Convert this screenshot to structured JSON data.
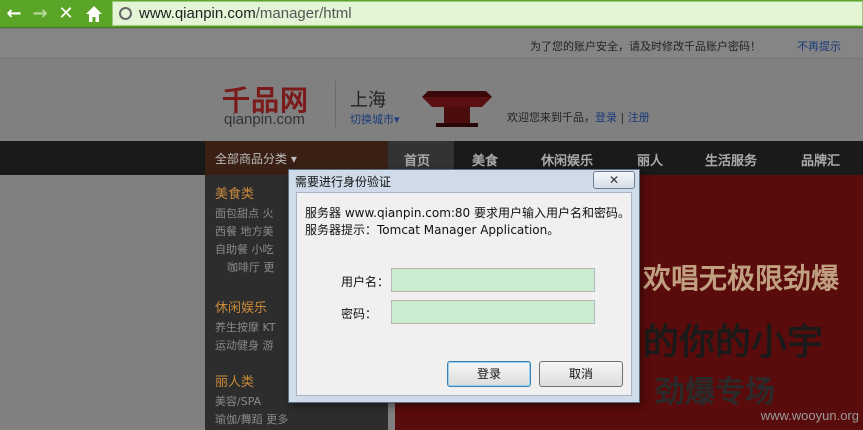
{
  "browser": {
    "url_host": "www.qianpin.com",
    "url_path": "/manager/html",
    "back_icon": "arrow-left",
    "forward_icon": "arrow-right",
    "stop_icon": "close",
    "home_icon": "home"
  },
  "notice": {
    "text": "为了您的账户安全，请及时修改千品账户密码！",
    "link": "不再提示"
  },
  "header": {
    "logo_cn": "千品网",
    "logo_en": "qianpin.com",
    "city": "上海",
    "city_switch": "切换城市▾",
    "welcome": "欢迎您来到千品，",
    "login": "登录",
    "separator": "|",
    "register": "注册"
  },
  "nav": {
    "all_categories": "全部商品分类 ▾",
    "items": [
      "首页",
      "美食",
      "休闲娱乐",
      "丽人",
      "生活服务",
      "品牌汇"
    ]
  },
  "sidebar": {
    "groups": [
      {
        "title": "美食类",
        "items": [
          "面包甜点  火",
          "西餐  地方美",
          "自助餐  小吃",
          "咖啡厅  更"
        ]
      },
      {
        "title": "休闲娱乐",
        "items": [
          "养生按摩  KT",
          "运动健身  游"
        ]
      },
      {
        "title": "丽人类",
        "items": [
          "美容/SPA",
          "瑜伽/舞蹈  更多"
        ]
      }
    ]
  },
  "banner": {
    "line1": "欢唱无极限劲爆",
    "line2": "的你的小宇",
    "line3": "劲爆专场"
  },
  "watermark": "www.wooyun.org",
  "dialog": {
    "title": "需要进行身份验证",
    "close_label": "✕",
    "message_line1": "服务器 www.qianpin.com:80 要求用户输入用户名和密码。",
    "message_line2": "服务器提示：Tomcat Manager Application。",
    "username_label": "用户名：",
    "password_label": "密码：",
    "username_value": "",
    "password_value": "",
    "login_button": "登录",
    "cancel_button": "取消"
  }
}
